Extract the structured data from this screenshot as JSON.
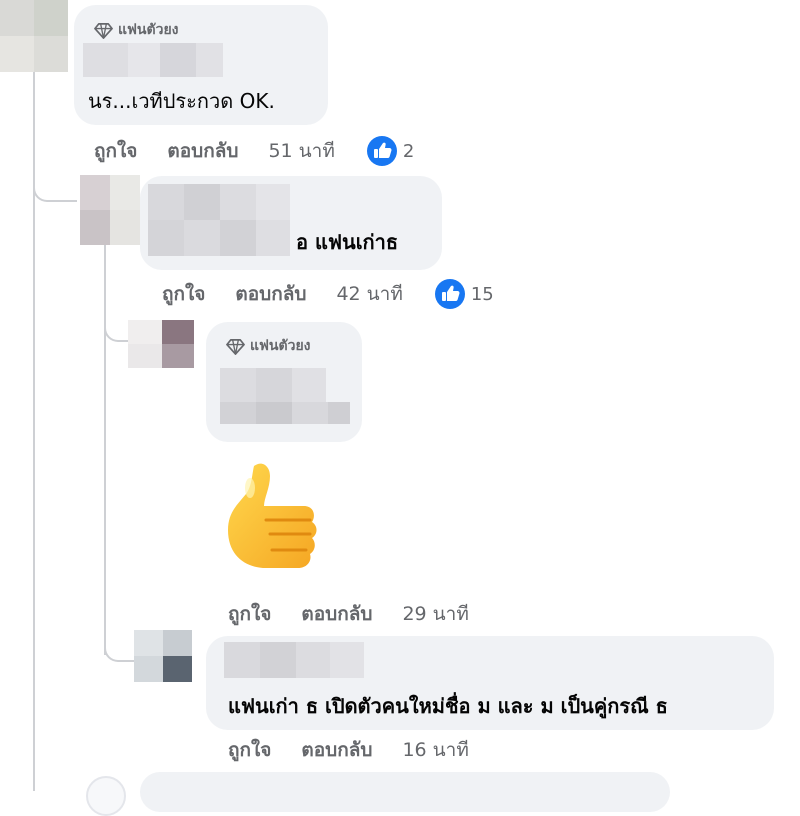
{
  "badge_label": "แฟนตัวยง",
  "comments": [
    {
      "text": "นร...เวทีประกวด OK.",
      "actions": {
        "like": "ถูกใจ",
        "reply": "ตอบกลับ",
        "time": "51 นาที"
      },
      "reaction_count": "2"
    },
    {
      "text": "อ แฟนเก่าธ",
      "actions": {
        "like": "ถูกใจ",
        "reply": "ตอบกลับ",
        "time": "42 นาที"
      },
      "reaction_count": "15"
    },
    {
      "sticker": "thumbs-up",
      "actions": {
        "like": "ถูกใจ",
        "reply": "ตอบกลับ",
        "time": "29 นาที"
      }
    },
    {
      "text": "แฟนเก่า ธ เปิดตัวคนใหม่ชื่อ ม และ ม เป็นคู่กรณี ธ",
      "actions": {
        "like": "ถูกใจ",
        "reply": "ตอบกลับ",
        "time": "16 นาที"
      }
    }
  ],
  "colors": {
    "bubble": "#f0f2f5",
    "meta": "#65676b",
    "like_blue": "#1877f2",
    "thread": "#ced0d4"
  }
}
